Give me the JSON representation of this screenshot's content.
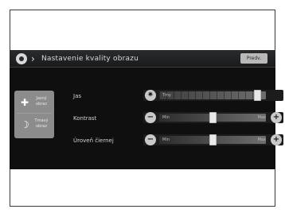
{
  "screen": {
    "title": "Nastavenie kvality obrazu",
    "default_button": "Predv."
  },
  "left_panel": {
    "items": [
      {
        "label": "Jasný obraz",
        "icon": "sun-icon"
      },
      {
        "label": "Tmavý obraz",
        "icon": "moon-icon"
      }
    ]
  },
  "settings": [
    {
      "label": "Jas",
      "min_label": "Tmy",
      "max_label": "",
      "level": 0.95,
      "left_icon": "sun-icon",
      "right_icon": ""
    },
    {
      "label": "Kontrast",
      "min_label": "Min",
      "max_label": "Max",
      "level": 0.5,
      "left_icon": "minus-icon",
      "right_icon": "plus-icon"
    },
    {
      "label": "Úroveň čiernej",
      "min_label": "Min",
      "max_label": "Max",
      "level": 0.5,
      "left_icon": "minus-icon",
      "right_icon": "plus-icon"
    }
  ]
}
